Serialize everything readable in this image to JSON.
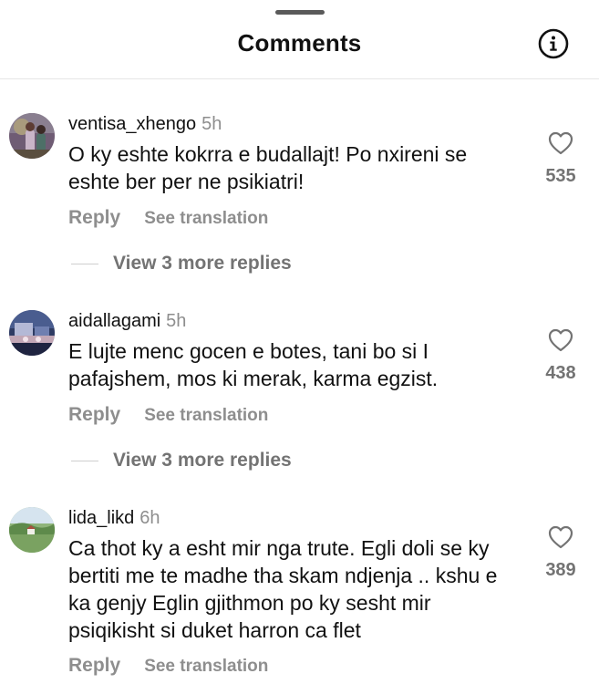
{
  "header": {
    "title": "Comments"
  },
  "comments": [
    {
      "username": "ventisa_xhengo",
      "time": "5h",
      "text": "O ky eshte kokrra e budallajt! Po nxireni se eshte ber per ne psikiatri!",
      "likes": "535",
      "reply_label": "Reply",
      "translation_label": "See translation",
      "more_replies": "View 3 more replies"
    },
    {
      "username": "aidallagami",
      "time": "5h",
      "text": "E lujte menc gocen e botes, tani bo si I pafajshem, mos ki merak, karma egzist.",
      "likes": "438",
      "reply_label": "Reply",
      "translation_label": "See translation",
      "more_replies": "View 3 more replies"
    },
    {
      "username": "lida_likd",
      "time": "6h",
      "text": "Ca thot ky a esht mir nga trute. Egli doli se ky bertiti me te madhe tha skam ndjenja .. kshu e ka genjy Eglin gjithmon po ky sesht mir psiqikisht si duket harron ca flet",
      "likes": "389",
      "reply_label": "Reply",
      "translation_label": "See translation"
    }
  ],
  "icons": {
    "info": "info-icon",
    "like": "heart-icon"
  },
  "colors": {
    "primary_text": "#111111",
    "secondary_text": "#8e8e8e",
    "divider": "#e6e6e6"
  }
}
